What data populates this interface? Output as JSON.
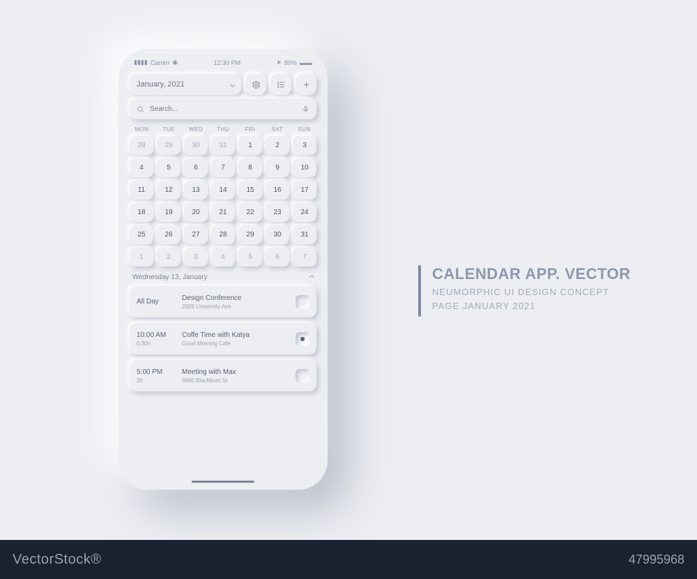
{
  "status_bar": {
    "carrier": "Carrier",
    "time": "12:30 PM",
    "battery": "80%"
  },
  "header": {
    "month_label": "January, 2021",
    "settings_icon": "gear-icon",
    "list_icon": "list-icon",
    "add_icon": "plus-icon"
  },
  "search": {
    "placeholder": "Search..."
  },
  "dow": [
    "MON",
    "TUE",
    "WED",
    "THU",
    "FRI",
    "SAT",
    "SUN"
  ],
  "days": [
    {
      "n": "28",
      "out": true
    },
    {
      "n": "29",
      "out": true
    },
    {
      "n": "30",
      "out": true
    },
    {
      "n": "31",
      "out": true
    },
    {
      "n": "1"
    },
    {
      "n": "2"
    },
    {
      "n": "3"
    },
    {
      "n": "4"
    },
    {
      "n": "5"
    },
    {
      "n": "6"
    },
    {
      "n": "7"
    },
    {
      "n": "8"
    },
    {
      "n": "9"
    },
    {
      "n": "10"
    },
    {
      "n": "11"
    },
    {
      "n": "12"
    },
    {
      "n": "13"
    },
    {
      "n": "14"
    },
    {
      "n": "15"
    },
    {
      "n": "16"
    },
    {
      "n": "17"
    },
    {
      "n": "18"
    },
    {
      "n": "19"
    },
    {
      "n": "20"
    },
    {
      "n": "21"
    },
    {
      "n": "22"
    },
    {
      "n": "23"
    },
    {
      "n": "24"
    },
    {
      "n": "25"
    },
    {
      "n": "26"
    },
    {
      "n": "27"
    },
    {
      "n": "28"
    },
    {
      "n": "29"
    },
    {
      "n": "30"
    },
    {
      "n": "31"
    },
    {
      "n": "1",
      "out": true
    },
    {
      "n": "2",
      "out": true
    },
    {
      "n": "3",
      "out": true
    },
    {
      "n": "4",
      "out": true
    },
    {
      "n": "5",
      "out": true
    },
    {
      "n": "6",
      "out": true
    },
    {
      "n": "7",
      "out": true
    }
  ],
  "selected_label": "Wednesday 13, January",
  "events": [
    {
      "time": "All Day",
      "dur": "",
      "title": "Design Conference",
      "loc": "2828 University Ave",
      "checked": false
    },
    {
      "time": "10:00 AM",
      "dur": "0.30h",
      "title": "Coffe Time with Katya",
      "loc": "Good Morning Cafe",
      "checked": true
    },
    {
      "time": "5:00 PM",
      "dur": "2h",
      "title": "Meeting with Max",
      "loc": "9680 Blackburn St",
      "checked": false
    }
  ],
  "caption": {
    "title": "CALENDAR APP. VECTOR",
    "line1": "NEUMORPHIC UI DESIGN CONCEPT",
    "line2": "PAGE JANUARY 2021"
  },
  "footer": {
    "watermark": "VectorStock®",
    "code": "47995968"
  }
}
